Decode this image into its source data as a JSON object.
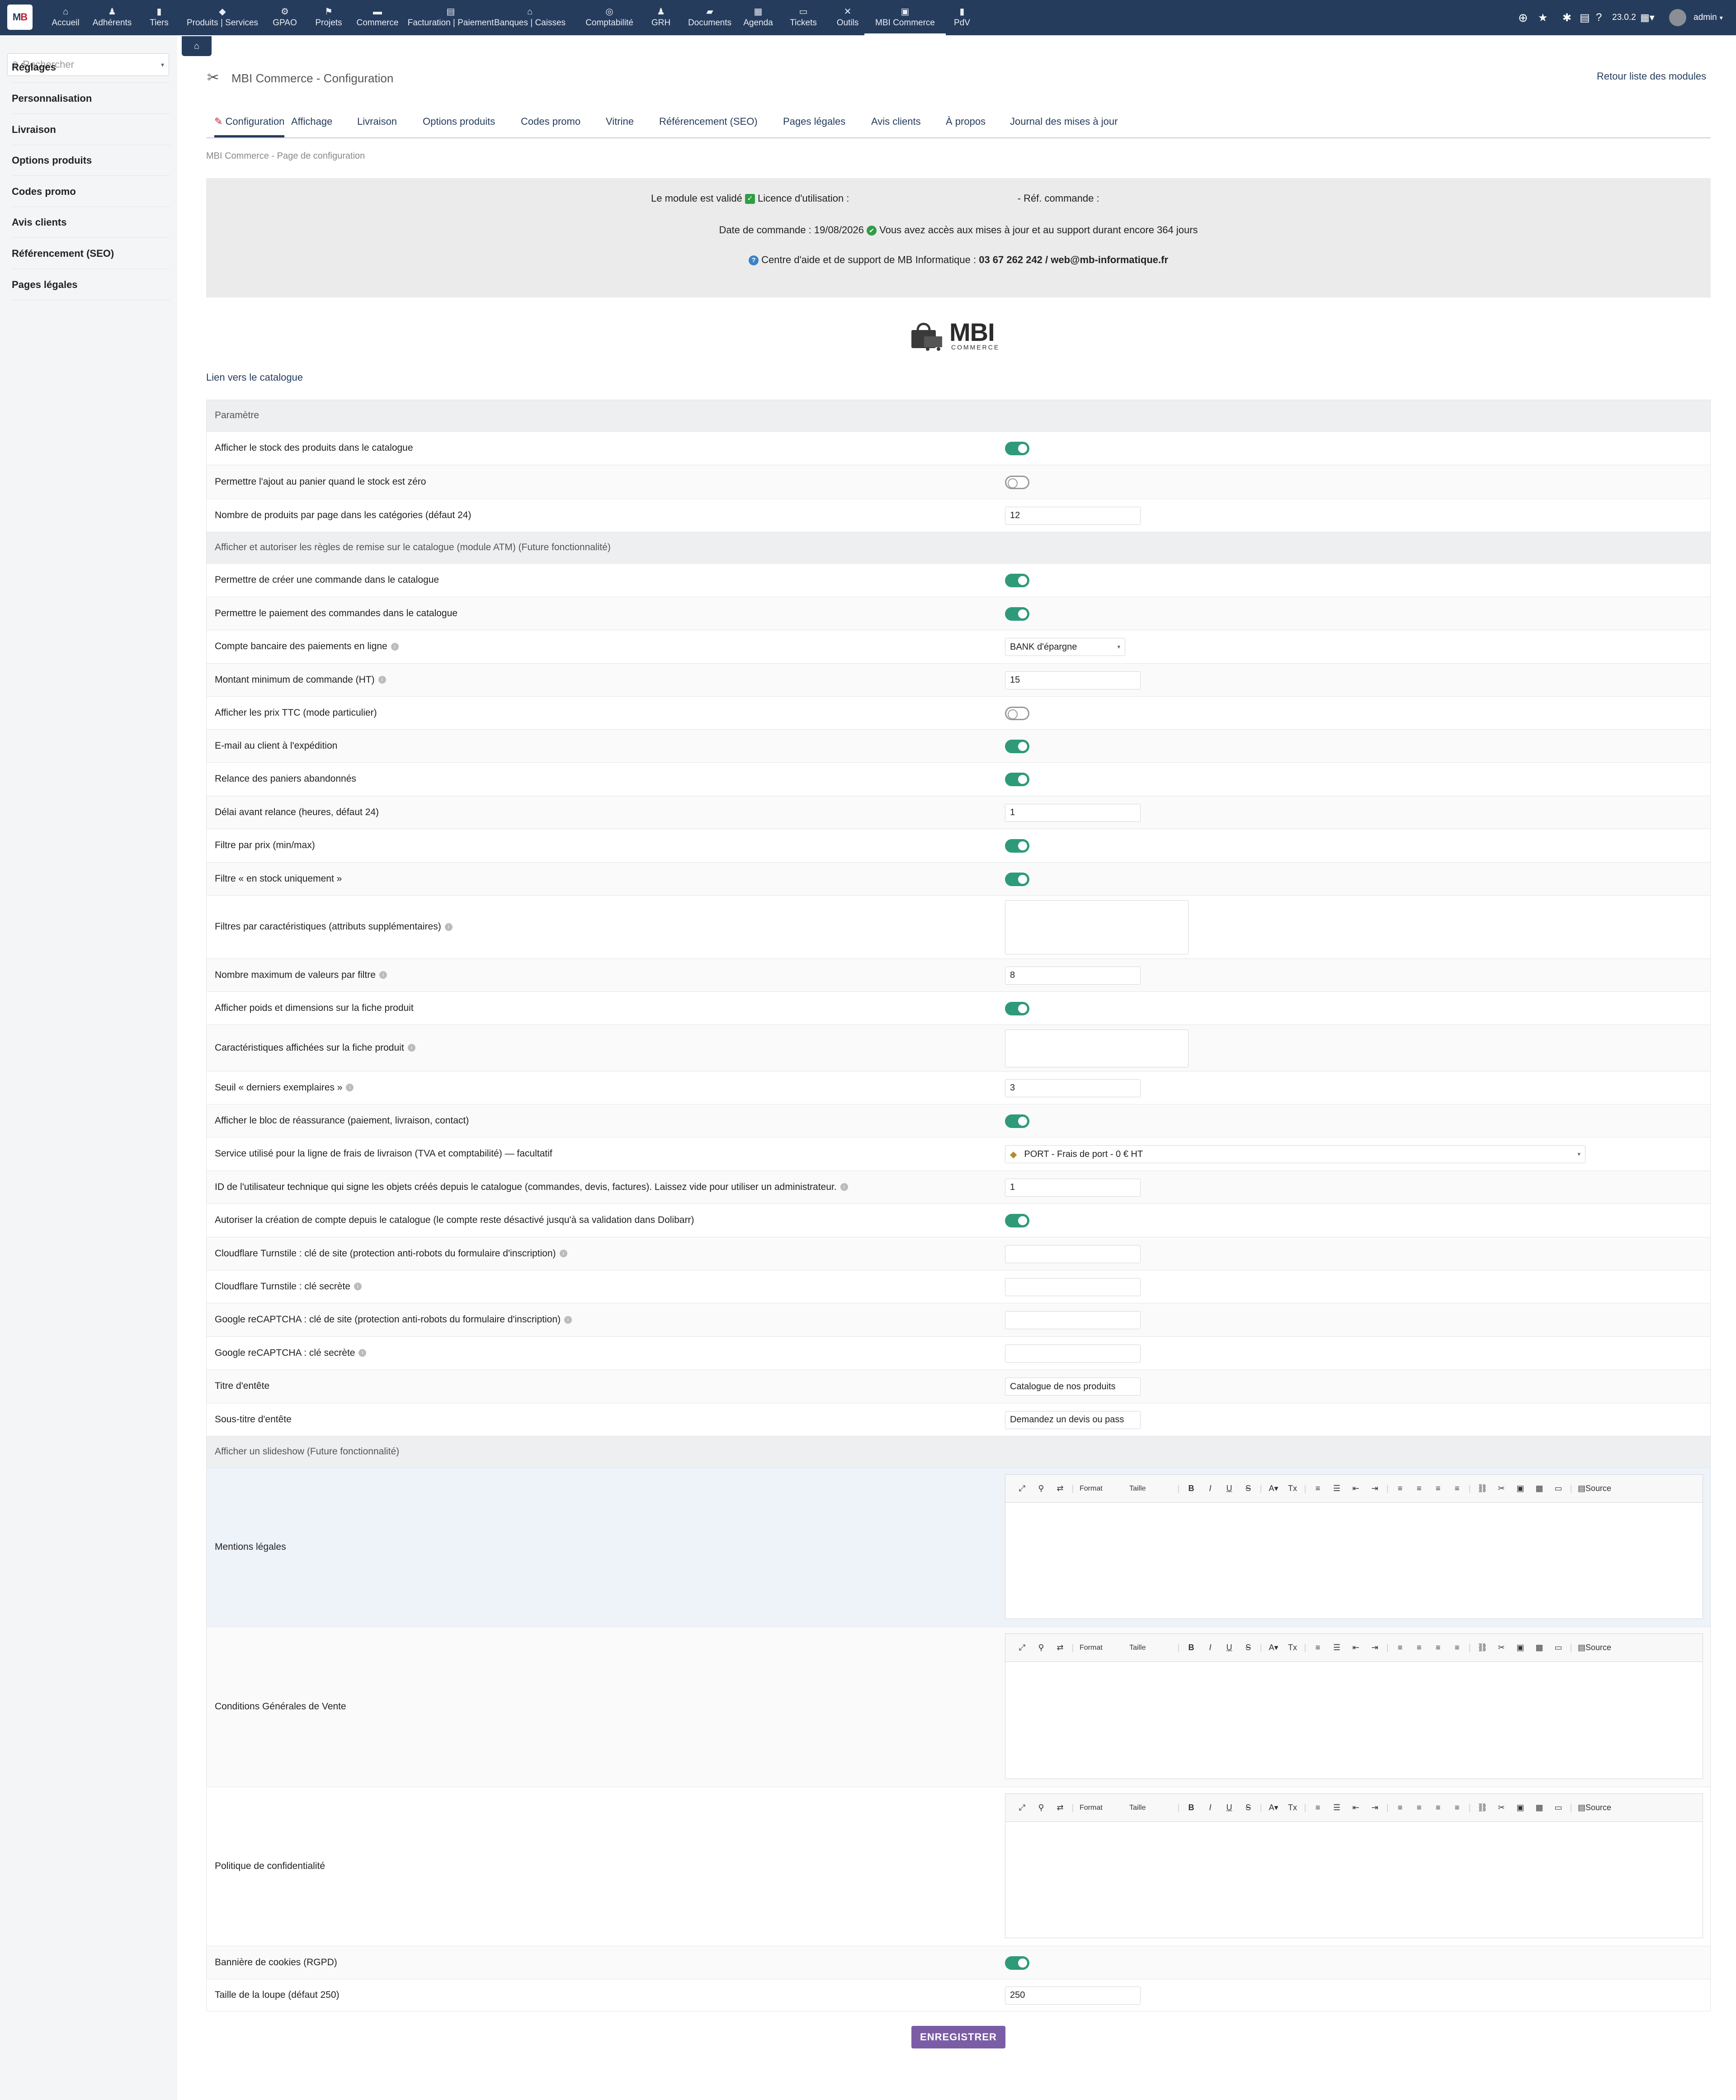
{
  "topbar": {
    "menu": [
      {
        "label": "Accueil",
        "icon": "home-icon",
        "glyph": "⌂"
      },
      {
        "label": "Adhérents",
        "icon": "members-icon",
        "glyph": "♟"
      },
      {
        "label": "Tiers",
        "icon": "building-icon",
        "glyph": "▮"
      },
      {
        "label": "Produits | Services",
        "icon": "cube-icon",
        "glyph": "◆"
      },
      {
        "label": "GPAO",
        "icon": "factory-icon",
        "glyph": "⚙"
      },
      {
        "label": "Projets",
        "icon": "project-icon",
        "glyph": "⚑"
      },
      {
        "label": "Commerce",
        "icon": "commerce-icon",
        "glyph": "▬"
      },
      {
        "label": "Facturation | Paiement",
        "icon": "invoice-icon",
        "glyph": "▤"
      },
      {
        "label": "Banques | Caisses",
        "icon": "bank-icon",
        "glyph": "⌂"
      },
      {
        "label": "Comptabilité",
        "icon": "accounting-icon",
        "glyph": "◎"
      },
      {
        "label": "GRH",
        "icon": "hr-icon",
        "glyph": "♟"
      },
      {
        "label": "Documents",
        "icon": "folder-icon",
        "glyph": "▰"
      },
      {
        "label": "Agenda",
        "icon": "calendar-icon",
        "glyph": "▦"
      },
      {
        "label": "Tickets",
        "icon": "ticket-icon",
        "glyph": "▭"
      },
      {
        "label": "Outils",
        "icon": "tools-icon",
        "glyph": "✕"
      },
      {
        "label": "MBI Commerce",
        "icon": "store-icon",
        "glyph": "▣"
      },
      {
        "label": "PdV",
        "icon": "pos-icon",
        "glyph": "▮"
      }
    ],
    "version": "23.0.2",
    "user": "admin"
  },
  "sidebar": {
    "search_placeholder": "Rechercher",
    "items": [
      "Réglages",
      "Personnalisation",
      "Livraison",
      "Options produits",
      "Codes promo",
      "Avis clients",
      "Référencement (SEO)",
      "Pages légales"
    ]
  },
  "header": {
    "title": "MBI Commerce - Configuration",
    "back_link": "Retour liste des modules",
    "breadcrumb": "MBI Commerce - Page de configuration"
  },
  "tabs": [
    "Configuration",
    "Affichage",
    "Livraison",
    "Options produits",
    "Codes promo",
    "Vitrine",
    "Référencement (SEO)",
    "Pages légales",
    "Avis clients",
    "À propos",
    "Journal des mises à jour"
  ],
  "info": {
    "validated": "Le module est validé",
    "licence": "Licence d'utilisation :",
    "order_ref": "- Réf. commande :",
    "order_date": "Date de commande : 19/08/2026",
    "support_access": "Vous avez accès aux mises à jour et au support durant encore 364 jours",
    "help_center": "Centre d'aide et de support de MB Informatique :",
    "help_contact": "03 67 262 242 / web@mb-informatique.fr"
  },
  "brand": {
    "name": "MBI",
    "sub": "COMMERCE"
  },
  "catalog_link": "Lien vers le catalogue",
  "settings": {
    "rows": [
      {
        "label": "Paramètre",
        "kind": "section"
      },
      {
        "label": "Afficher le stock des produits dans le catalogue",
        "kind": "toggle",
        "on": true
      },
      {
        "label": "Permettre l'ajout au panier quand le stock est zéro",
        "kind": "toggle",
        "on": false
      },
      {
        "label": "Nombre de produits par page dans les catégories (défaut 24)",
        "kind": "input",
        "value": "12"
      },
      {
        "label": "Afficher et autoriser les règles de remise sur le catalogue (module ATM) (Future fonctionnalité)",
        "kind": "section"
      },
      {
        "label": "Permettre de créer une commande dans le catalogue",
        "kind": "toggle",
        "on": true
      },
      {
        "label": "Permettre le paiement des commandes dans le catalogue",
        "kind": "toggle",
        "on": true
      },
      {
        "label": "Compte bancaire des paiements en ligne",
        "kind": "select",
        "value": "BANK d'épargne",
        "info": true
      },
      {
        "label": "Montant minimum de commande (HT)",
        "kind": "input",
        "value": "15",
        "info": true
      },
      {
        "label": "Afficher les prix TTC (mode particulier)",
        "kind": "toggle",
        "on": false
      },
      {
        "label": "E-mail au client à l'expédition",
        "kind": "toggle",
        "on": true
      },
      {
        "label": "Relance des paniers abandonnés",
        "kind": "toggle",
        "on": true
      },
      {
        "label": "Délai avant relance (heures, défaut 24)",
        "kind": "input",
        "value": "1"
      },
      {
        "label": "Filtre par prix (min/max)",
        "kind": "toggle",
        "on": true
      },
      {
        "label": "Filtre « en stock uniquement »",
        "kind": "toggle",
        "on": true
      },
      {
        "label": "Filtres par caractéristiques (attributs supplémentaires)",
        "kind": "textarea",
        "value": "",
        "info": true
      },
      {
        "label": "Nombre maximum de valeurs par filtre",
        "kind": "input",
        "value": "8",
        "info": true
      },
      {
        "label": "Afficher poids et dimensions sur la fiche produit",
        "kind": "toggle",
        "on": true
      },
      {
        "label": "Caractéristiques affichées sur la fiche produit",
        "kind": "textarea",
        "value": "",
        "info": true
      },
      {
        "label": "Seuil « derniers exemplaires »",
        "kind": "input",
        "value": "3",
        "info": true
      },
      {
        "label": "Afficher le bloc de réassurance (paiement, livraison, contact)",
        "kind": "toggle",
        "on": true
      },
      {
        "label": "Service utilisé pour la ligne de frais de livraison (TVA et comptabilité) — facultatif",
        "kind": "select-wide",
        "value": "PORT - Frais de port - 0 € HT"
      },
      {
        "label": "ID de l'utilisateur technique qui signe les objets créés depuis le catalogue (commandes, devis, factures). Laissez vide pour utiliser un administrateur.",
        "kind": "input",
        "value": "1",
        "info": true
      },
      {
        "label": "Autoriser la création de compte depuis le catalogue (le compte reste désactivé jusqu'à sa validation dans Dolibarr)",
        "kind": "toggle",
        "on": true
      },
      {
        "label": "Cloudflare Turnstile : clé de site (protection anti-robots du formulaire d'inscription)",
        "kind": "input",
        "value": "",
        "info": true
      },
      {
        "label": "Cloudflare Turnstile : clé secrète",
        "kind": "input",
        "value": "",
        "info": true
      },
      {
        "label": "Google reCAPTCHA : clé de site (protection anti-robots du formulaire d'inscription)",
        "kind": "input",
        "value": "",
        "info": true
      },
      {
        "label": "Google reCAPTCHA : clé secrète",
        "kind": "input",
        "value": "",
        "info": true
      },
      {
        "label": "Titre d'entête",
        "kind": "input",
        "value": "Catalogue de nos produits"
      },
      {
        "label": "Sous-titre d'entête",
        "kind": "input",
        "value": "Demandez un devis ou pass"
      },
      {
        "label": "Afficher un slideshow (Future fonctionnalité)",
        "kind": "section"
      },
      {
        "label": "Mentions légales",
        "kind": "editor"
      },
      {
        "label": "Conditions Générales de Vente",
        "kind": "editor"
      },
      {
        "label": "Politique de confidentialité",
        "kind": "editor"
      },
      {
        "label": "Bannière de cookies (RGPD)",
        "kind": "toggle",
        "on": true
      },
      {
        "label": "Taille de la loupe (défaut 250)",
        "kind": "input",
        "value": "250"
      }
    ]
  },
  "editor_toolbar": {
    "format": "Format",
    "size": "Taille",
    "source": "Source"
  },
  "save_label": "ENREGISTRER",
  "colors": {
    "topbar": "#263c5c",
    "toggle_on": "#2e9a7a",
    "save": "#7b5da5"
  }
}
